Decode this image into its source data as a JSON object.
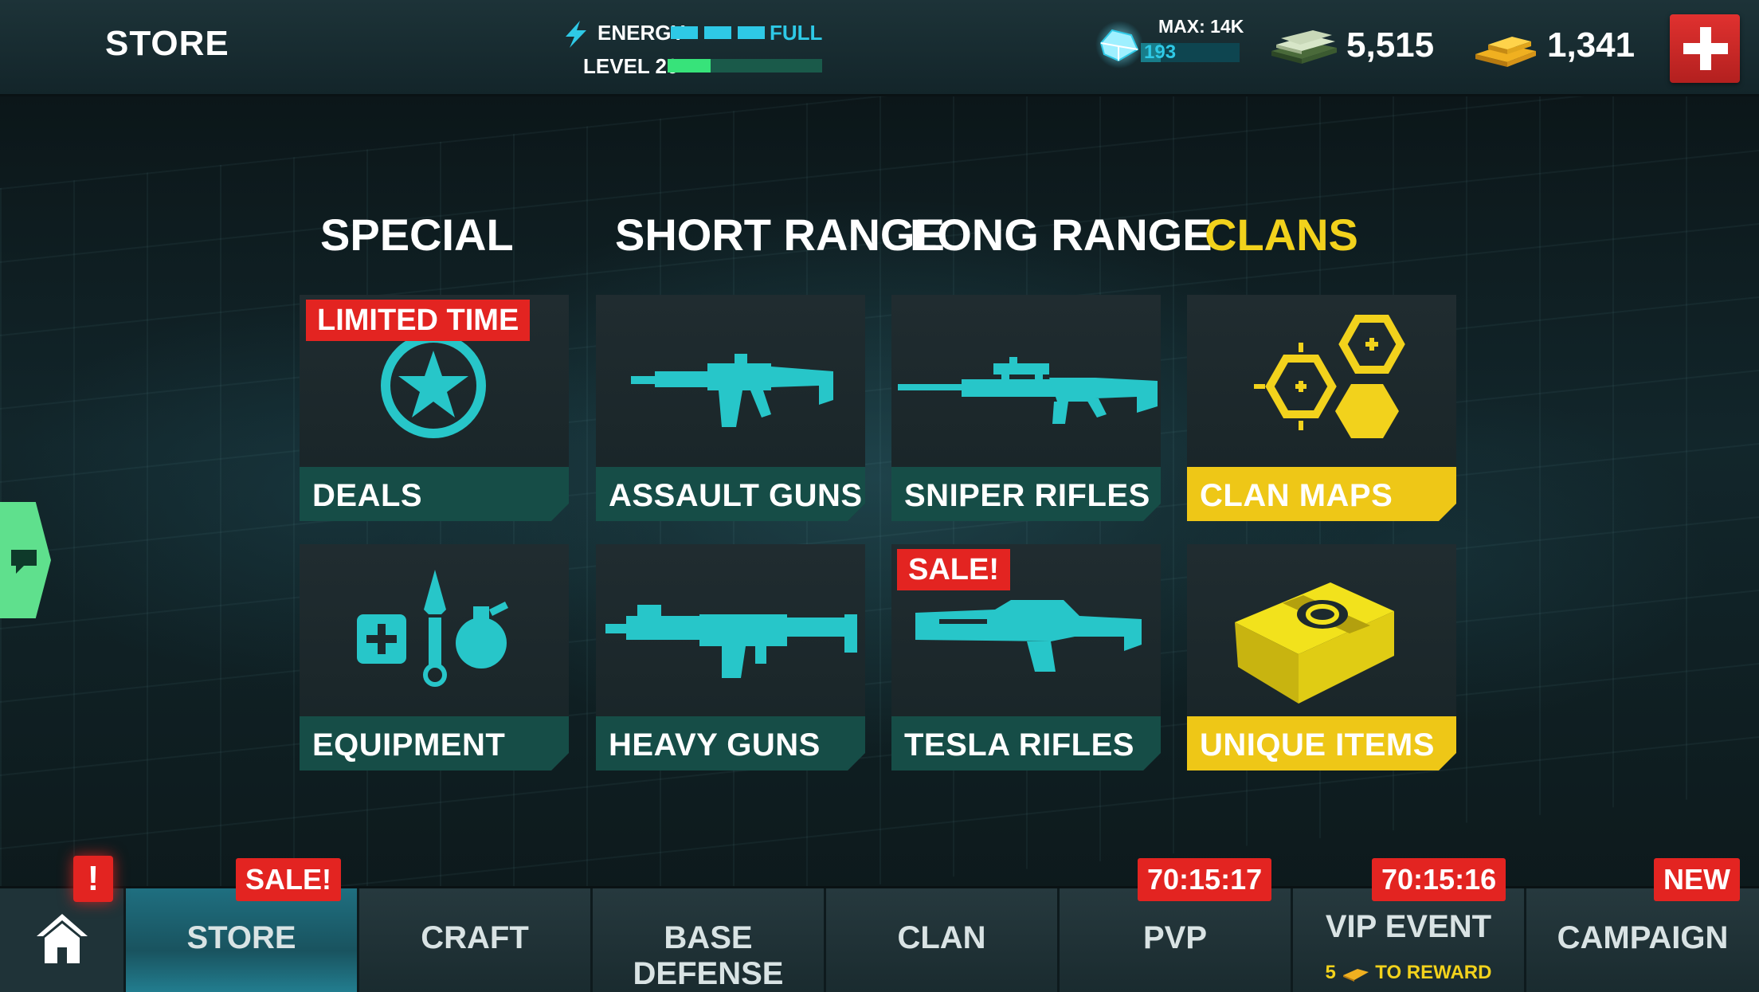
{
  "header": {
    "title": "STORE",
    "energy": {
      "label": "ENERGY",
      "status": "FULL",
      "segments": 3
    },
    "level": {
      "label": "LEVEL 20",
      "progress": 0.28
    },
    "gems": {
      "max_label": "MAX: 14K",
      "count": "193",
      "progress": 0.2
    },
    "cash": "5,515",
    "gold": "1,341"
  },
  "categories": [
    "SPECIAL",
    "SHORT RANGE",
    "LONG RANGE",
    "CLANS"
  ],
  "tiles": {
    "deals": {
      "label": "DEALS",
      "badge": "LIMITED TIME"
    },
    "assault_guns": {
      "label": "ASSAULT GUNS"
    },
    "sniper_rifles": {
      "label": "SNIPER RIFLES"
    },
    "clan_maps": {
      "label": "CLAN MAPS"
    },
    "equipment": {
      "label": "EQUIPMENT"
    },
    "heavy_guns": {
      "label": "HEAVY GUNS"
    },
    "tesla_rifles": {
      "label": "TESLA RIFLES",
      "badge": "SALE!"
    },
    "unique_items": {
      "label": "UNIQUE ITEMS"
    }
  },
  "nav": {
    "alert": "!",
    "tabs": [
      {
        "label": "STORE",
        "badge": "SALE!"
      },
      {
        "label": "CRAFT"
      },
      {
        "label": "BASE DEFENSE"
      },
      {
        "label": "CLAN"
      },
      {
        "label": "PVP",
        "badge": "70:15:17"
      },
      {
        "label": "VIP EVENT",
        "badge": "70:15:16",
        "sub": "5",
        "sub_suffix": "TO REWARD"
      },
      {
        "label": "CAMPAIGN",
        "badge": "NEW"
      }
    ]
  },
  "colors": {
    "accent_cyan": "#2ec9e6",
    "accent_gold": "#f2d21c",
    "badge_red": "#e32421",
    "tile_label_teal": "#164d47"
  }
}
